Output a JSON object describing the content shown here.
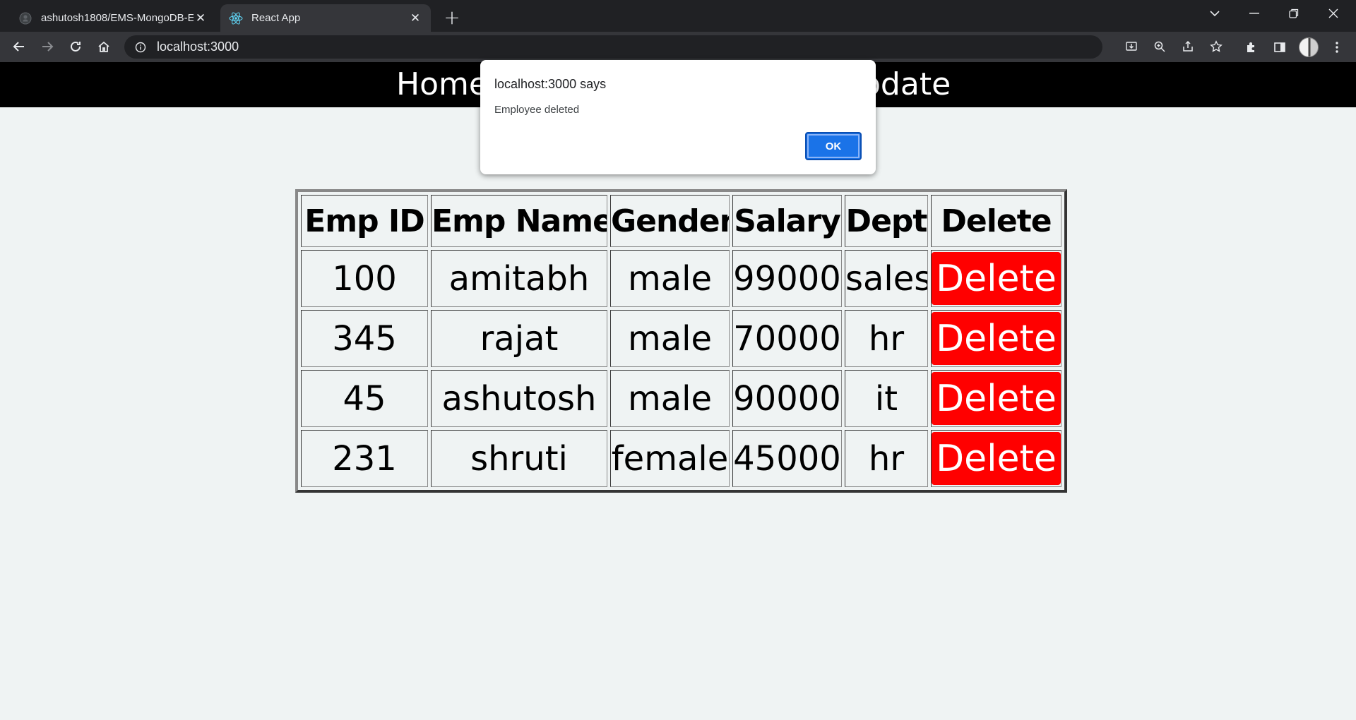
{
  "browser": {
    "tabs": [
      {
        "title": "ashutosh1808/EMS-MongoDB-E",
        "icon": "github-icon",
        "active": false
      },
      {
        "title": "React App",
        "icon": "react-icon",
        "active": true
      }
    ],
    "url": "localhost:3000"
  },
  "navbar": {
    "home": "Home",
    "update": "pdate"
  },
  "table": {
    "headers": [
      "Emp ID",
      "Emp Name",
      "Gender",
      "Salary",
      "Dept",
      "Delete"
    ],
    "rows": [
      {
        "id": "100",
        "name": "amitabh",
        "gender": "male",
        "salary": "99000",
        "dept": "sales",
        "action": "Delete"
      },
      {
        "id": "345",
        "name": "rajat",
        "gender": "male",
        "salary": "70000",
        "dept": "hr",
        "action": "Delete"
      },
      {
        "id": "45",
        "name": "ashutosh",
        "gender": "male",
        "salary": "90000",
        "dept": "it",
        "action": "Delete"
      },
      {
        "id": "231",
        "name": "shruti",
        "gender": "female",
        "salary": "45000",
        "dept": "hr",
        "action": "Delete"
      }
    ]
  },
  "dialog": {
    "title": "localhost:3000 says",
    "message": "Employee deleted",
    "ok_label": "OK"
  },
  "colors": {
    "delete_button": "#ff0000",
    "navbar_bg": "#000000",
    "page_bg": "#eff3f3",
    "ok_button": "#1a73e8"
  }
}
